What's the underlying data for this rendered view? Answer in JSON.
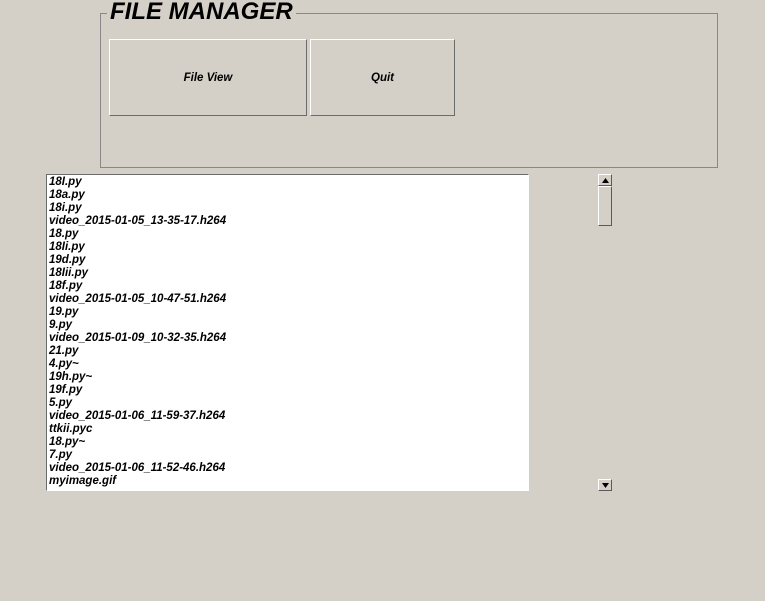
{
  "frame": {
    "legend": "FILE MANAGER",
    "buttons": {
      "file_view": "File View",
      "quit": "Quit"
    }
  },
  "files": [
    "18I.py",
    "18a.py",
    "18i.py",
    "video_2015-01-05_13-35-17.h264",
    "18.py",
    "18Ii.py",
    "19d.py",
    "18Iii.py",
    "18f.py",
    "video_2015-01-05_10-47-51.h264",
    "19.py",
    "9.py",
    "video_2015-01-09_10-32-35.h264",
    "21.py",
    "4.py~",
    "19h.py~",
    "19f.py",
    "5.py",
    "video_2015-01-06_11-59-37.h264",
    "ttkii.pyc",
    "18.py~",
    "7.py",
    "video_2015-01-06_11-52-46.h264",
    "myimage.gif"
  ]
}
